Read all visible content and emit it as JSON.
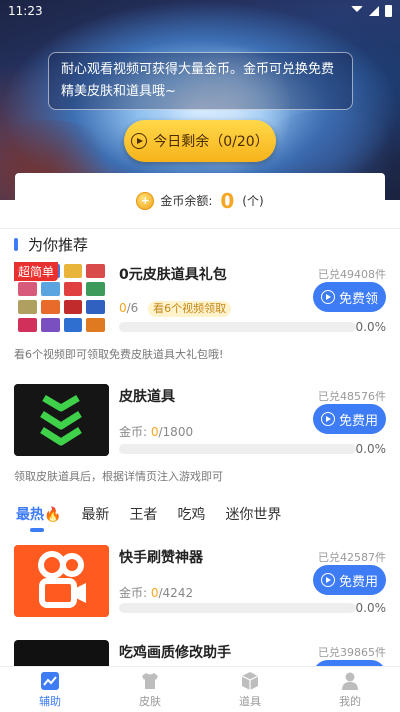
{
  "status_bar": {
    "time": "11:23"
  },
  "hero": {
    "notice": "耐心观看视频可获得大量金币。金币可兑换免费精美皮肤和道具哦~",
    "remaining_label": "今日剩余（0/20）"
  },
  "balance": {
    "label": "金币余额:",
    "amount": "0",
    "unit": "(个)"
  },
  "section": {
    "title": "为你推荐"
  },
  "items": [
    {
      "ribbon": "超简单",
      "title": "0元皮肤道具礼包",
      "redeemed": "已兑49408件",
      "progress_current": "0",
      "progress_total": "/6",
      "badge": "看6个视频领取",
      "button": "免费领",
      "percent": "0.0%",
      "progress_value": 0,
      "desc": "看6个视频即可领取免费皮肤道具大礼包哦!"
    },
    {
      "title": "皮肤道具",
      "redeemed": "已兑48576件",
      "coins_label": "金币: ",
      "coins_current": "0",
      "coins_total": "/1800",
      "button": "免费用",
      "percent": "0.0%",
      "progress_value": 0,
      "desc": "领取皮肤道具后，根据详情页注入游戏即可"
    },
    {
      "title": "快手刷赞神器",
      "redeemed": "已兑42587件",
      "coins_label": "金币: ",
      "coins_current": "0",
      "coins_total": "/4242",
      "button": "免费用",
      "percent": "0.0%",
      "progress_value": 0
    },
    {
      "title": "吃鸡画质修改助手",
      "redeemed": "已兑39865件"
    }
  ],
  "tabs": [
    "最热🔥",
    "最新",
    "王者",
    "吃鸡",
    "迷你世界"
  ],
  "bottom_nav": [
    {
      "label": "辅助",
      "icon": "chart-icon",
      "active": true
    },
    {
      "label": "皮肤",
      "icon": "shirt-icon",
      "active": false
    },
    {
      "label": "道具",
      "icon": "box-icon",
      "active": false
    },
    {
      "label": "我的",
      "icon": "user-icon",
      "active": false
    }
  ],
  "colors": {
    "accent": "#3d7cf5",
    "coin": "#f5a623",
    "ribbon": "#e9302f"
  }
}
